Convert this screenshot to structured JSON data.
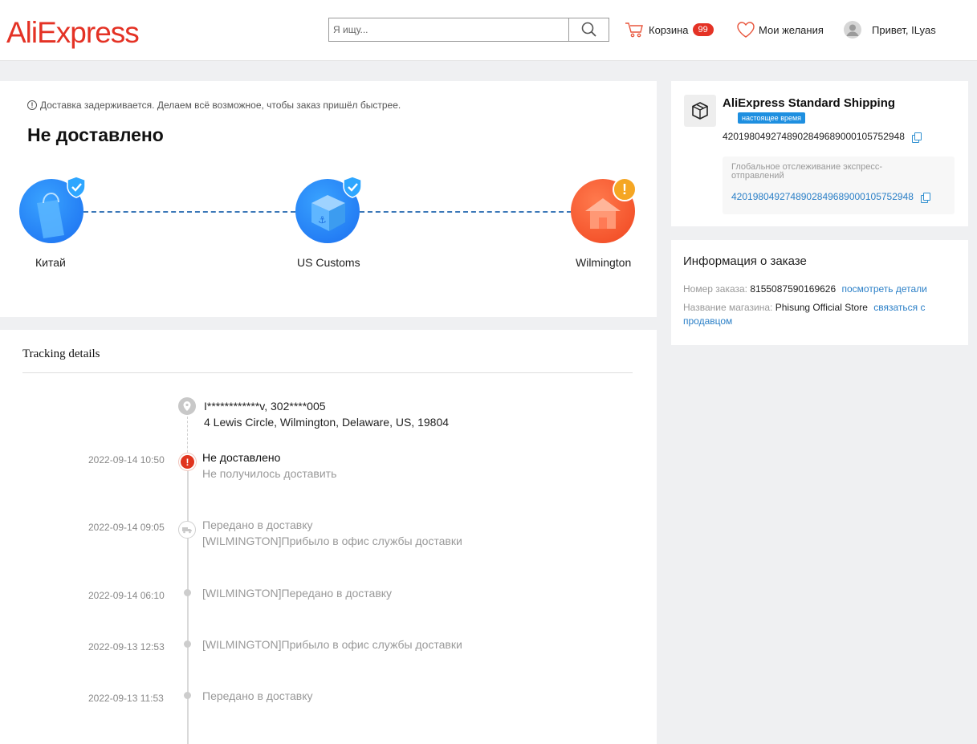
{
  "header": {
    "logo": "AliExpress",
    "search_placeholder": "Я ищу...",
    "cart_label": "Корзина",
    "cart_count": "99",
    "wishlist_label": "Мои желания",
    "greeting": "Привет, ILyas"
  },
  "status": {
    "notice": "Доставка задерживается. Делаем всё возможное, чтобы заказ пришёл быстрее.",
    "title": "Не доставлено",
    "route": [
      {
        "label": "Китай",
        "state": "done",
        "color": "#1b6ef0"
      },
      {
        "label": "US Customs",
        "state": "done",
        "color": "#1b6ef0"
      },
      {
        "label": "Wilmington",
        "state": "warning",
        "color": "#f0451f"
      }
    ]
  },
  "tracking": {
    "title": "Tracking details",
    "recipient": "I************v,  302****005",
    "address": "4 Lewis Circle,  Wilmington,  Delaware,  US,  19804",
    "events": [
      {
        "time": "2022-09-14 10:50",
        "title": "Не доставлено",
        "subtitle": "Не получилось доставить",
        "type": "error"
      },
      {
        "time": "2022-09-14 09:05",
        "title": "Передано в доставку",
        "subtitle": "[WILMINGTON]Прибыло в офис службы доставки",
        "type": "truck"
      },
      {
        "time": "2022-09-14 06:10",
        "title": "[WILMINGTON]Передано в доставку",
        "subtitle": "",
        "type": "dot"
      },
      {
        "time": "2022-09-13 12:53",
        "title": "[WILMINGTON]Прибыло в офис службы доставки",
        "subtitle": "",
        "type": "dot"
      },
      {
        "time": "2022-09-13 11:53",
        "title": "Передано в доставку",
        "subtitle": "",
        "type": "dot"
      }
    ]
  },
  "shipping": {
    "name": "AliExpress Standard Shipping",
    "tag": "настоящее время",
    "tracking_number": "420198049274890284968900010575294​8",
    "global_label": "Глобальное отслеживание экспресс-отправлений",
    "global_number": "4201980492748902849689000105752948"
  },
  "order": {
    "title": "Информация о заказе",
    "number_label": "Номер заказа:",
    "number_value": "8155087590169626",
    "details_link": "посмотреть детали",
    "store_label": "Название магазина:",
    "store_value": "Phisung Official Store",
    "contact_link": "связаться с продавцом"
  },
  "colors": {
    "brand": "#e43225",
    "link": "#2a7fc7",
    "route_blue": "#1b6ef0",
    "route_red": "#f0451f",
    "warning": "#f5a623"
  }
}
